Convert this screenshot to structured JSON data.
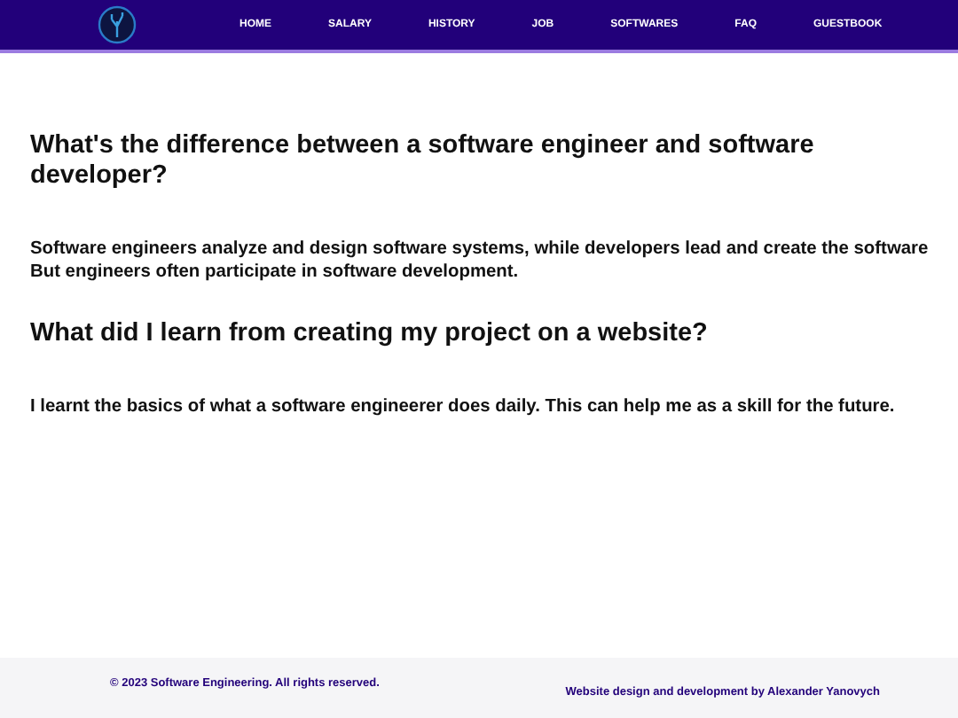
{
  "nav": {
    "items": [
      {
        "label": "HOME"
      },
      {
        "label": "SALARY"
      },
      {
        "label": "HISTORY"
      },
      {
        "label": "JOB"
      },
      {
        "label": "SOFTWARES"
      },
      {
        "label": "FAQ"
      },
      {
        "label": "GUESTBOOK"
      }
    ]
  },
  "sections": [
    {
      "heading": "What's the difference between a software engineer and software developer?",
      "answer_lines": [
        "Software engineers analyze and design software systems, while developers lead and create the software",
        "But engineers often participate in software development."
      ]
    },
    {
      "heading": "What did I learn from creating my project on a website?",
      "answer_lines": [
        "I learnt the basics of what a software engineerer does daily. This can help me as a skill for the future."
      ]
    }
  ],
  "footer": {
    "copyright": "© 2023 Software Engineering. All rights reserved.",
    "credit": "Website design and development by Alexander Yanovych"
  }
}
